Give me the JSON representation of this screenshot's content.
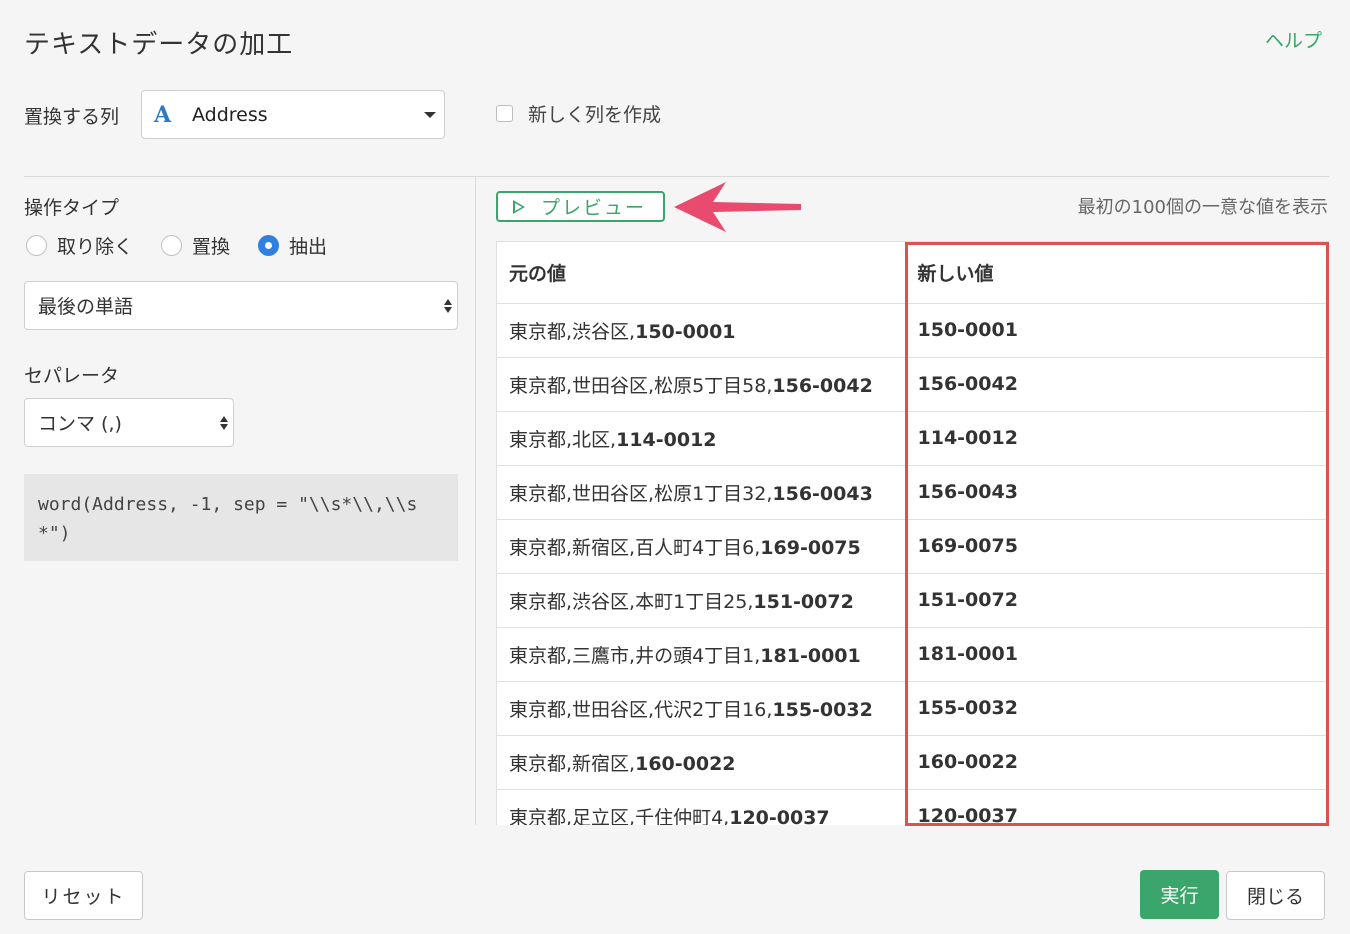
{
  "dialog": {
    "title": "テキストデータの加工",
    "help_label": "ヘルプ"
  },
  "column": {
    "label": "置換する列",
    "type_icon": "A",
    "selected": "Address",
    "new_column_label": "新しく列を作成",
    "new_column_checked": false
  },
  "operation": {
    "label": "操作タイプ",
    "options": [
      "取り除く",
      "置換",
      "抽出"
    ],
    "selected": "抽出",
    "mode_selected": "最後の単語"
  },
  "separator": {
    "label": "セパレータ",
    "selected": "コンマ (,)"
  },
  "code": "word(Address, -1, sep = \"\\\\s*\\\\,\\\\s*\")",
  "preview": {
    "button_label": "プレビュー",
    "note": "最初の100個の一意な値を表示",
    "columns": [
      "元の値",
      "新しい値"
    ],
    "rows": [
      {
        "prefix": "東京都,渋谷区,",
        "zip": "150-0001",
        "new": "150-0001"
      },
      {
        "prefix": "東京都,世田谷区,松原5丁目58,",
        "zip": "156-0042",
        "new": "156-0042"
      },
      {
        "prefix": "東京都,北区,",
        "zip": "114-0012",
        "new": "114-0012"
      },
      {
        "prefix": "東京都,世田谷区,松原1丁目32,",
        "zip": "156-0043",
        "new": "156-0043"
      },
      {
        "prefix": "東京都,新宿区,百人町4丁目6,",
        "zip": "169-0075",
        "new": "169-0075"
      },
      {
        "prefix": "東京都,渋谷区,本町1丁目25,",
        "zip": "151-0072",
        "new": "151-0072"
      },
      {
        "prefix": "東京都,三鷹市,井の頭4丁目1,",
        "zip": "181-0001",
        "new": "181-0001"
      },
      {
        "prefix": "東京都,世田谷区,代沢2丁目16,",
        "zip": "155-0032",
        "new": "155-0032"
      },
      {
        "prefix": "東京都,新宿区,",
        "zip": "160-0022",
        "new": "160-0022"
      },
      {
        "prefix": "東京都,足立区,千住仲町4,",
        "zip": "120-0037",
        "new": "120-0037"
      }
    ]
  },
  "footer": {
    "reset_label": "リセット",
    "run_label": "実行",
    "close_label": "閉じる"
  },
  "colors": {
    "accent_green": "#3aa66b",
    "highlight_red": "#d9534f",
    "arrow_pink": "#e94b6e",
    "radio_blue": "#2f80e0"
  }
}
